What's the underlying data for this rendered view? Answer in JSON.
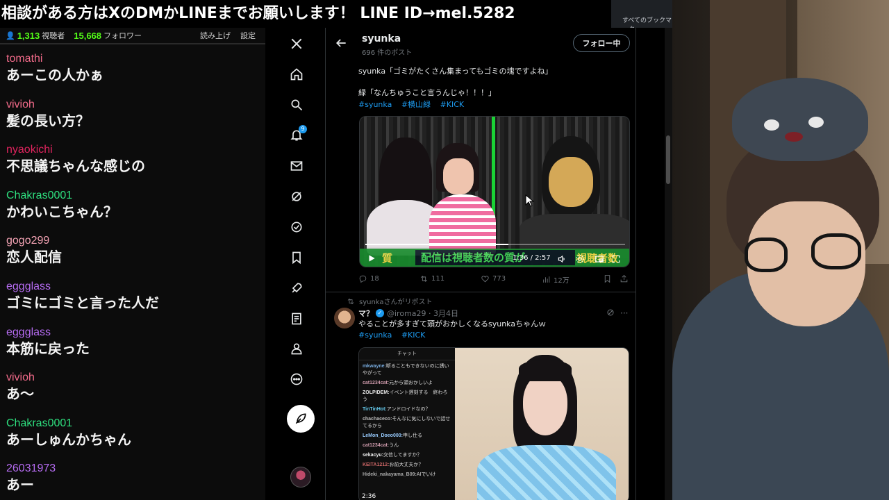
{
  "banner": {
    "text": "相談がある方はXのDMかLINEまでお願いします！ LINE ID→mel.5282"
  },
  "browser": {
    "bookmarks_label": "すべてのブックマーク"
  },
  "chat": {
    "header": {
      "viewers": "1,313",
      "viewers_label": "視聴者",
      "followers": "15,668",
      "followers_label": "フォロワー",
      "readout_label": "読み上げ",
      "settings_label": "設定"
    },
    "messages": [
      {
        "user": "tomathi",
        "color": "#f26b8a",
        "text": "あーこの人かぁ"
      },
      {
        "user": "vivioh",
        "color": "#f26b8a",
        "text": "髪の長い方？"
      },
      {
        "user": "nyaokichi",
        "color": "#e0245e",
        "text": "不思議ちゃんな感じの"
      },
      {
        "user": "Chakras0001",
        "color": "#2ee07f",
        "text": "かわいこちゃん？"
      },
      {
        "user": "gogo299",
        "color": "#f4a3b4",
        "text": "恋人配信"
      },
      {
        "user": "eggglass",
        "color": "#b66cf2",
        "text": "ゴミにゴミと言った人だ"
      },
      {
        "user": "eggglass",
        "color": "#b66cf2",
        "text": "本筋に戻った"
      },
      {
        "user": "vivioh",
        "color": "#f26b8a",
        "text": "あ〜"
      },
      {
        "user": "Chakras0001",
        "color": "#2ee07f",
        "text": "あーしゅんかちゃん"
      },
      {
        "user": "26031973",
        "color": "#b66cf2",
        "text": "あー"
      }
    ]
  },
  "xnav": {
    "icons": [
      "x-logo-icon",
      "home-icon",
      "search-icon",
      "notifications-icon",
      "messages-icon",
      "grok-icon",
      "verified-icon",
      "bookmarks-icon",
      "rocket-icon",
      "articles-icon",
      "profile-icon",
      "more-icon"
    ],
    "notification_count": "9"
  },
  "feed": {
    "profile_name": "syunka",
    "post_count": "696 件のポスト",
    "follow_label": "フォロー中",
    "tweet1": {
      "line1": "syunka「ゴミがたくさん集まってもゴミの塊ですよね」",
      "line2": "緑「なんちゅうこと言うんじゃ！！！」",
      "tags": [
        "#syunka",
        "#横山緑",
        "#KICK"
      ],
      "video_caption": "配信は視聴者数の質が",
      "video_caption_left": "質",
      "video_caption_right": "視聴者数",
      "video_time": "1:36 / 2:57",
      "video_progress": 0.55,
      "replies": "18",
      "reposts": "111",
      "likes": "773",
      "views": "12万"
    },
    "repost_label": "syunkaさんがリポスト",
    "tweet2": {
      "name": "マ？",
      "handle": "@iroma29 · 3月4日",
      "text": "やることが多すぎて頭がおかしくなるsyunkaちゃんｗ",
      "tags": [
        "#syunka",
        "#KICK"
      ],
      "chat_title": "チャット",
      "chat_lines": [
        {
          "user": "mkwayne:",
          "color": "#7ad",
          "text": "断ることもできないのに誘いやがって"
        },
        {
          "user": "cat1234cat:",
          "color": "#c9a",
          "text": "元から頭おかしいよ"
        },
        {
          "user": "ZOLPIDEM:",
          "color": "#eee",
          "text": "イベント遅刻する　終わろう"
        },
        {
          "user": "TinTinHot:",
          "color": "#6ce",
          "text": "アンドロイドなの？"
        },
        {
          "user": "chachaceco:",
          "color": "#bbb",
          "text": "そんなに気にしないで話せてるから"
        },
        {
          "user": "LeMon_Doeo000:",
          "color": "#9cf",
          "text": "申し仕る"
        },
        {
          "user": "cat1234cat:",
          "color": "#c9a",
          "text": "うん"
        },
        {
          "user": "sekacyu:",
          "color": "#eee",
          "text": "交信してますか？"
        },
        {
          "user": "KEITA1212:",
          "color": "#c66",
          "text": "お前大丈夫か？"
        },
        {
          "user": "Hideki_nakayama_B09:",
          "color": "#aaa",
          "text": "AIでいけ"
        }
      ],
      "video_time": "2:36"
    }
  }
}
